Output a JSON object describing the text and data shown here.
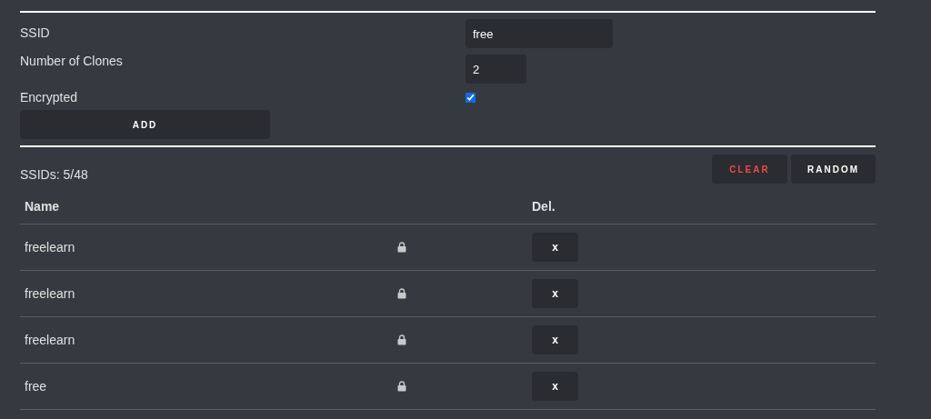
{
  "form": {
    "ssid": {
      "label": "SSID",
      "value": "free"
    },
    "clones": {
      "label": "Number of Clones",
      "value": "2"
    },
    "encrypted": {
      "label": "Encrypted",
      "checked": true
    },
    "add_button": "ADD"
  },
  "count": "SSIDs: 5/48",
  "clear_button": "CLEAR",
  "random_button": "RANDOM",
  "table": {
    "columns": [
      "Name",
      "Del."
    ],
    "rows": [
      {
        "name": "freelearn",
        "encrypted": true,
        "delete": "x"
      },
      {
        "name": "freelearn",
        "encrypted": true,
        "delete": "x"
      },
      {
        "name": "freelearn",
        "encrypted": true,
        "delete": "x"
      },
      {
        "name": "free",
        "encrypted": true,
        "delete": "x"
      }
    ]
  }
}
